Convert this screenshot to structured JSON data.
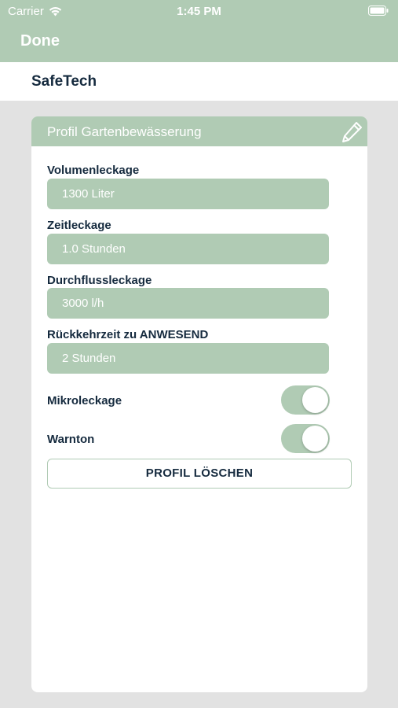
{
  "status_bar": {
    "carrier": "Carrier",
    "time": "1:45 PM"
  },
  "nav": {
    "done_label": "Done"
  },
  "app": {
    "title": "SafeTech"
  },
  "profile": {
    "title": "Profil Gartenbewässerung",
    "edit_icon": "pencil-icon",
    "fields": [
      {
        "label": "Volumenleckage",
        "value": "1300 Liter"
      },
      {
        "label": "Zeitleckage",
        "value": "1.0 Stunden"
      },
      {
        "label": "Durchflussleckage",
        "value": "3000 l/h"
      },
      {
        "label": "Rückkehrzeit zu ANWESEND",
        "value": "2 Stunden"
      }
    ],
    "toggles": [
      {
        "label": "Mikroleckage",
        "on": true
      },
      {
        "label": "Warnton",
        "on": true
      }
    ],
    "delete_label": "PROFIL LÖSCHEN"
  },
  "colors": {
    "accent": "#b0cbb4",
    "text_dark": "#152a3e",
    "background": "#e2e2e2"
  }
}
